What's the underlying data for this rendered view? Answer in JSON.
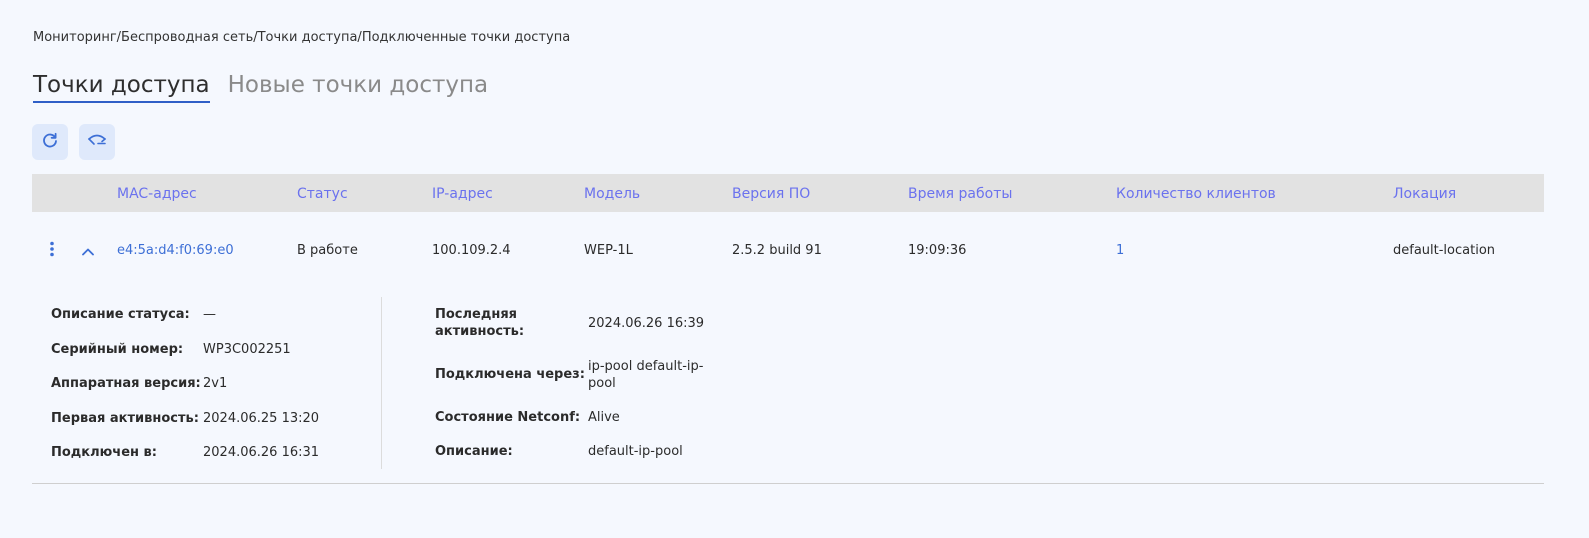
{
  "breadcrumb": "Мониторинг/Беспроводная сеть/Точки доступа/Подключенные точки доступа",
  "tabs": {
    "active": "Точки доступа",
    "inactive": "Новые точки доступа"
  },
  "toolbar": {
    "refresh_icon": "refresh-icon",
    "reboot_icon": "access-point-icon"
  },
  "table": {
    "headers": {
      "mac": "MAC-адрес",
      "status": "Статус",
      "ip": "IP-адрес",
      "model": "Модель",
      "firmware": "Версия ПО",
      "uptime": "Время работы",
      "clients": "Количество клиентов",
      "location": "Локация"
    },
    "row": {
      "mac": "e4:5a:d4:f0:69:e0",
      "status": "В работе",
      "ip": "100.109.2.4",
      "model": "WEP-1L",
      "firmware": "2.5.2 build 91",
      "uptime": "19:09:36",
      "clients": "1",
      "location": "default-location"
    }
  },
  "details": {
    "left": {
      "status_desc_label": "Описание статуса:",
      "status_desc_value": "—",
      "serial_label": "Серийный номер:",
      "serial_value": "WP3C002251",
      "hw_label": "Аппаратная версия:",
      "hw_value": "2v1",
      "first_active_label": "Первая активность:",
      "first_active_value": "2024.06.25 13:20",
      "connected_label": "Подключен в:",
      "connected_value": "2024.06.26 16:31"
    },
    "right": {
      "last_active_label_1": "Последняя",
      "last_active_label_2": "активность:",
      "last_active_value": "2024.06.26 16:39",
      "via_label": "Подключена через:",
      "via_value_1": "ip-pool default-ip-",
      "via_value_2": "pool",
      "netconf_label": "Состояние Netconf:",
      "netconf_value": "Alive",
      "desc_label": "Описание:",
      "desc_value": "default-ip-pool"
    }
  },
  "colors": {
    "accent": "#2f5fc7",
    "header_text": "#6b72ee",
    "link": "#3d6fd6",
    "background": "#f5f8fe"
  }
}
